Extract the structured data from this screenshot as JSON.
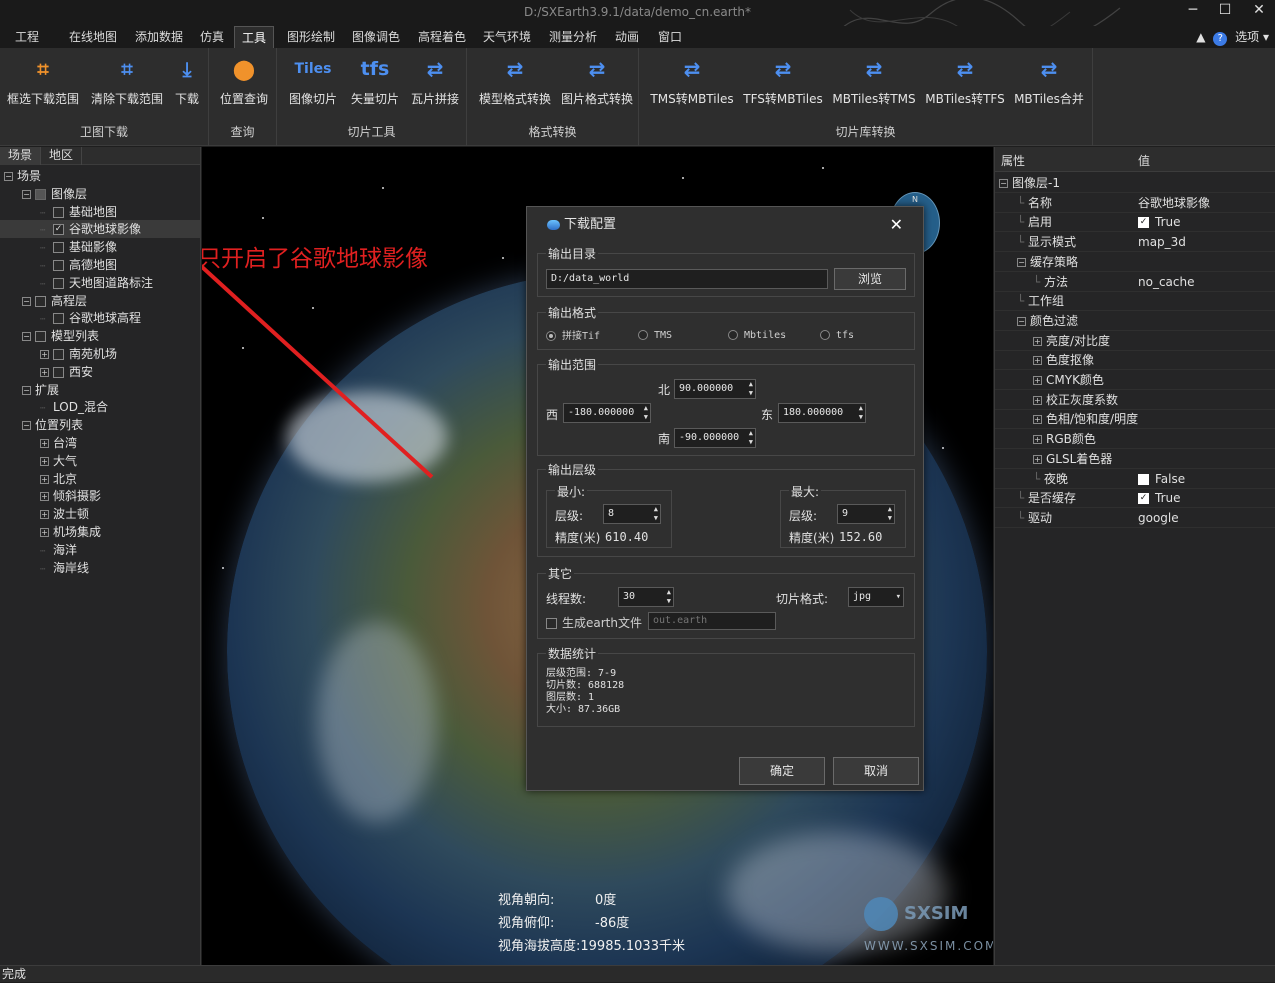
{
  "window": {
    "title": "D:/SXEarth3.9.1/data/demo_cn.earth*",
    "minimize": "─",
    "maximize": "☐",
    "close": "✕"
  },
  "menu": {
    "items": [
      "工程",
      "在线地图",
      "添加数据",
      "仿真",
      "工具",
      "图形绘制",
      "图像调色",
      "高程着色",
      "天气环境",
      "测量分析",
      "动画",
      "窗口"
    ],
    "active": "工具",
    "help": "?",
    "options": "选项"
  },
  "ribbon": {
    "groups": [
      {
        "label": "卫图下载",
        "buttons": [
          {
            "label": "框选下载范围",
            "icon": "crop-icon"
          },
          {
            "label": "清除下载范围",
            "icon": "crop-clear-icon"
          },
          {
            "label": "下载",
            "icon": "download-icon"
          }
        ]
      },
      {
        "label": "查询",
        "buttons": [
          {
            "label": "位置查询",
            "icon": "location-pin-icon"
          }
        ]
      },
      {
        "label": "切片工具",
        "buttons": [
          {
            "label": "图像切片",
            "icon_text": "Tiles"
          },
          {
            "label": "矢量切片",
            "icon_text": "tfs"
          },
          {
            "label": "瓦片拼接",
            "icon": "swap-arrows-icon"
          }
        ]
      },
      {
        "label": "格式转换",
        "buttons": [
          {
            "label": "模型格式转换",
            "icon": "swap-arrows-icon"
          },
          {
            "label": "图片格式转换",
            "icon": "swap-arrows-icon"
          }
        ]
      },
      {
        "label": "切片库转换",
        "buttons": [
          {
            "label": "TMS转MBTiles",
            "icon": "swap-arrows-icon"
          },
          {
            "label": "TFS转MBTiles",
            "icon": "swap-arrows-icon"
          },
          {
            "label": "MBTiles转TMS",
            "icon": "swap-arrows-icon"
          },
          {
            "label": "MBTiles转TFS",
            "icon": "swap-arrows-icon"
          },
          {
            "label": "MBTiles合并",
            "icon": "swap-arrows-icon"
          }
        ]
      }
    ]
  },
  "left_panel": {
    "tabs": [
      "场景",
      "地区"
    ],
    "tree": [
      {
        "label": "场景",
        "level": 0,
        "expander": "⊟",
        "checkbox": false
      },
      {
        "label": "图像层",
        "level": 1,
        "expander": "⊟",
        "checkbox": "dim"
      },
      {
        "label": "基础地图",
        "level": 2,
        "expander": "",
        "checkbox": "off"
      },
      {
        "label": "谷歌地球影像",
        "level": 2,
        "expander": "",
        "checkbox": "on",
        "selected": true
      },
      {
        "label": "基础影像",
        "level": 2,
        "expander": "",
        "checkbox": "off"
      },
      {
        "label": "高德地图",
        "level": 2,
        "expander": "",
        "checkbox": "off"
      },
      {
        "label": "天地图道路标注",
        "level": 2,
        "expander": "",
        "checkbox": "off"
      },
      {
        "label": "高程层",
        "level": 1,
        "expander": "⊟",
        "checkbox": "off"
      },
      {
        "label": "谷歌地球高程",
        "level": 2,
        "expander": "",
        "checkbox": "off"
      },
      {
        "label": "模型列表",
        "level": 1,
        "expander": "⊟",
        "checkbox": "off"
      },
      {
        "label": "南苑机场",
        "level": 2,
        "expander": "⊞",
        "checkbox": "off"
      },
      {
        "label": "西安",
        "level": 2,
        "expander": "⊞",
        "checkbox": "off"
      },
      {
        "label": "扩展",
        "level": 1,
        "expander": "⊟",
        "checkbox": false
      },
      {
        "label": "LOD_混合",
        "level": 2,
        "expander": "",
        "checkbox": false
      },
      {
        "label": "位置列表",
        "level": 1,
        "expander": "⊟",
        "checkbox": false
      },
      {
        "label": "台湾",
        "level": 2,
        "expander": "⊞",
        "checkbox": false
      },
      {
        "label": "大气",
        "level": 2,
        "expander": "⊞",
        "checkbox": false
      },
      {
        "label": "北京",
        "level": 2,
        "expander": "⊞",
        "checkbox": false
      },
      {
        "label": "倾斜摄影",
        "level": 2,
        "expander": "⊞",
        "checkbox": false
      },
      {
        "label": "波士顿",
        "level": 2,
        "expander": "⊞",
        "checkbox": false
      },
      {
        "label": "机场集成",
        "level": 2,
        "expander": "⊞",
        "checkbox": false
      },
      {
        "label": "海洋",
        "level": 2,
        "expander": "",
        "checkbox": false
      },
      {
        "label": "海岸线",
        "level": 2,
        "expander": "",
        "checkbox": false
      }
    ]
  },
  "annotation": {
    "text": "只开启了谷歌地球影像",
    "color": "#e02020"
  },
  "compass": {
    "n": "N"
  },
  "hud": {
    "heading_label": "视角朝向:",
    "heading_value": "0度",
    "pitch_label": "视角俯仰:",
    "pitch_value": "-86度",
    "altitude_label": "视角海拔高度:",
    "altitude_value": "19985.1033千米"
  },
  "logo": {
    "name": "SXSIM",
    "url": "WWW.SXSIM.COM"
  },
  "dialog": {
    "title": "下载配置",
    "close": "✕",
    "output_dir": {
      "legend": "输出目录",
      "value": "D:/data_world",
      "browse": "浏览"
    },
    "output_format": {
      "legend": "输出格式",
      "options": [
        "拼接Tif",
        "TMS",
        "Mbtiles",
        "tfs"
      ],
      "selected": "拼接Tif"
    },
    "output_range": {
      "legend": "输出范围",
      "north_label": "北",
      "north": "90.000000",
      "west_label": "西",
      "west": "-180.000000",
      "east_label": "东",
      "east": "180.000000",
      "south_label": "南",
      "south": "-90.000000"
    },
    "output_level": {
      "legend": "输出层级",
      "min_legend": "最小:",
      "min_level_label": "层级:",
      "min_level": "8",
      "min_precision_label": "精度(米)",
      "min_precision": "610.40",
      "max_legend": "最大:",
      "max_level_label": "层级:",
      "max_level": "9",
      "max_precision_label": "精度(米)",
      "max_precision": "152.60"
    },
    "other": {
      "legend": "其它",
      "threads_label": "线程数:",
      "threads": "30",
      "tile_format_label": "切片格式:",
      "tile_format": "jpg",
      "gen_earth_label": "生成earth文件",
      "gen_earth_checked": false,
      "earth_placeholder": "out.earth"
    },
    "stats": {
      "legend": "数据统计",
      "level_range": "层级范围: 7-9",
      "tiles": "切片数: 688128",
      "layers": "图层数: 1",
      "size": "大小: 87.36GB"
    },
    "ok": "确定",
    "cancel": "取消"
  },
  "properties": {
    "head_prop": "属性",
    "head_value": "值",
    "rows": [
      {
        "label": "图像层-1",
        "indent": 0,
        "expander": "⊟",
        "value": ""
      },
      {
        "label": "名称",
        "indent": 1,
        "expander": "",
        "value": "谷歌地球影像"
      },
      {
        "label": "启用",
        "indent": 1,
        "expander": "",
        "value": "True",
        "check": "on"
      },
      {
        "label": "显示模式",
        "indent": 1,
        "expander": "",
        "value": "map_3d"
      },
      {
        "label": "缓存策略",
        "indent": 1,
        "expander": "⊟",
        "value": ""
      },
      {
        "label": "方法",
        "indent": 2,
        "expander": "",
        "value": "no_cache"
      },
      {
        "label": "工作组",
        "indent": 1,
        "expander": "",
        "value": ""
      },
      {
        "label": "颜色过滤",
        "indent": 1,
        "expander": "⊟",
        "value": ""
      },
      {
        "label": "亮度/对比度",
        "indent": 2,
        "expander": "⊞",
        "value": ""
      },
      {
        "label": "色度抠像",
        "indent": 2,
        "expander": "⊞",
        "value": ""
      },
      {
        "label": "CMYK颜色",
        "indent": 2,
        "expander": "⊞",
        "value": ""
      },
      {
        "label": "校正灰度系数",
        "indent": 2,
        "expander": "⊞",
        "value": ""
      },
      {
        "label": "色相/饱和度/明度",
        "indent": 2,
        "expander": "⊞",
        "value": ""
      },
      {
        "label": "RGB颜色",
        "indent": 2,
        "expander": "⊞",
        "value": ""
      },
      {
        "label": "GLSL着色器",
        "indent": 2,
        "expander": "⊞",
        "value": ""
      },
      {
        "label": "夜晚",
        "indent": 2,
        "expander": "",
        "value": "False",
        "check": "off"
      },
      {
        "label": "是否缓存",
        "indent": 1,
        "expander": "",
        "value": "True",
        "check": "on"
      },
      {
        "label": "驱动",
        "indent": 1,
        "expander": "",
        "value": "google"
      }
    ]
  },
  "status": {
    "text": "完成"
  }
}
